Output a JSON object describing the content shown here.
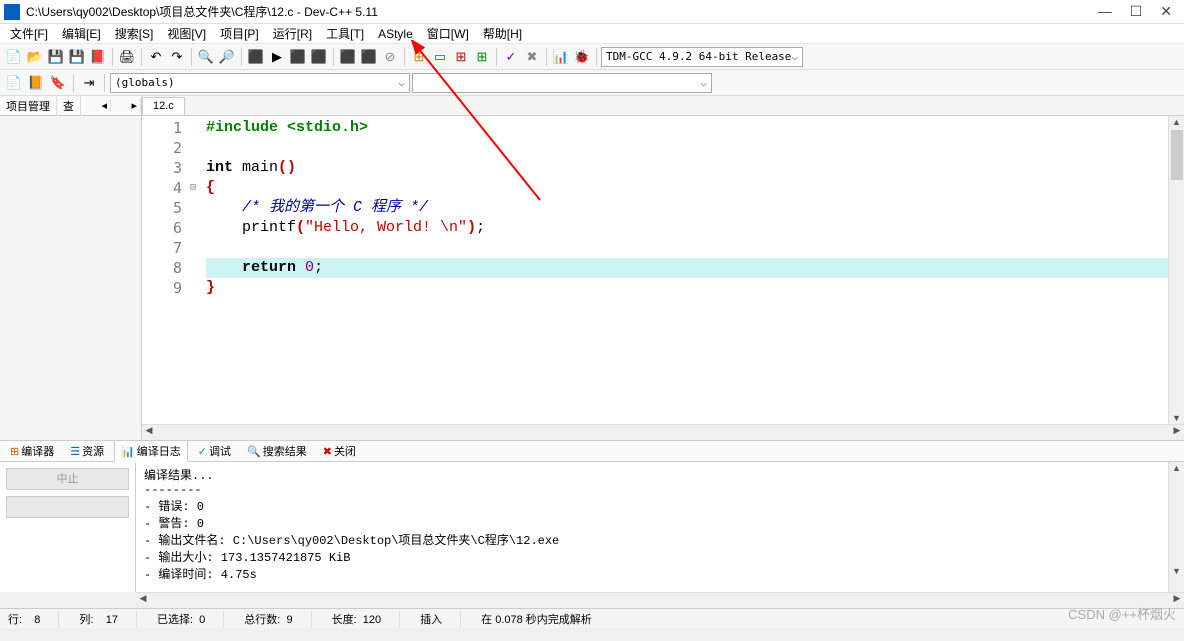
{
  "window": {
    "title": "C:\\Users\\qy002\\Desktop\\项目总文件夹\\C程序\\12.c - Dev-C++ 5.11"
  },
  "menu": {
    "items": [
      "文件[F]",
      "编辑[E]",
      "搜索[S]",
      "视图[V]",
      "项目[P]",
      "运行[R]",
      "工具[T]",
      "AStyle",
      "窗口[W]",
      "帮助[H]"
    ]
  },
  "toolbar": {
    "compiler_profile": "TDM-GCC 4.9.2 64-bit Release",
    "globals": "(globals)"
  },
  "sidetabs": {
    "t0": "项目管理",
    "t1": "查"
  },
  "editor": {
    "tab": "12.c",
    "lines": [
      {
        "n": 1,
        "html": "<span class='pp'>#include &lt;stdio.h&gt;</span>"
      },
      {
        "n": 2,
        "html": ""
      },
      {
        "n": 3,
        "html": "<span class='kw'>int</span> <span class='fn'>main</span><span class='paren'>()</span>"
      },
      {
        "n": 4,
        "html": "<span class='brace'>{</span>"
      },
      {
        "n": 5,
        "html": "    <span class='cm'>/* 我的第一个 C 程序 */</span>"
      },
      {
        "n": 6,
        "html": "    printf<span class='paren'>(</span><span class='str'>\"Hello, World! \\n\"</span><span class='paren'>)</span>;"
      },
      {
        "n": 7,
        "html": ""
      },
      {
        "n": 8,
        "html": "    <span class='kw'>return</span> <span class='num'>0</span>;",
        "current": true
      },
      {
        "n": 9,
        "html": "<span class='brace'>}</span>"
      }
    ]
  },
  "bottomtabs": {
    "t0": "编译器",
    "t1": "资源",
    "t2": "编译日志",
    "t3": "调试",
    "t4": "搜索结果",
    "t5": "关闭"
  },
  "log": {
    "abort": "中止",
    "header": "编译结果...",
    "lines": [
      "- 错误: 0",
      "- 警告: 0",
      "- 输出文件名: C:\\Users\\qy002\\Desktop\\项目总文件夹\\C程序\\12.exe",
      "- 输出大小: 173.1357421875 KiB",
      "- 编译时间: 4.75s"
    ]
  },
  "status": {
    "row_label": "行:",
    "row": "8",
    "col_label": "列:",
    "col": "17",
    "sel_label": "已选择:",
    "sel": "0",
    "lines_label": "总行数:",
    "lines": "9",
    "len_label": "长度:",
    "len": "120",
    "ins": "插入",
    "parse": "在 0.078 秒内完成解析"
  },
  "watermark": "CSDN @++杯烟火"
}
